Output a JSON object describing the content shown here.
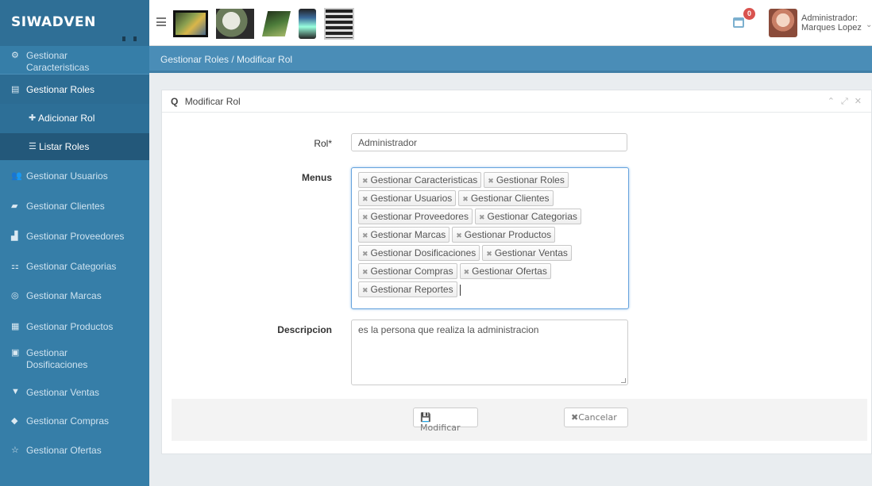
{
  "brand": {
    "name": "SIWADVEN"
  },
  "header": {
    "notification_count": "0",
    "user": {
      "role": "Administrador:",
      "name": "Marques Lopez"
    }
  },
  "sidebar": {
    "items": [
      {
        "label": "Gestionar Caracteristicas",
        "icon": "gears-icon"
      },
      {
        "label": "Gestionar Roles",
        "icon": "table-icon"
      },
      {
        "label": "Adicionar Rol",
        "icon": "plus-icon"
      },
      {
        "label": "Listar Roles",
        "icon": "list-icon"
      },
      {
        "label": "Gestionar Usuarios",
        "icon": "users-icon"
      },
      {
        "label": "Gestionar Clientes",
        "icon": "briefcase-icon"
      },
      {
        "label": "Gestionar Proveedores",
        "icon": "truck-icon"
      },
      {
        "label": "Gestionar Categorias",
        "icon": "sitemap-icon"
      },
      {
        "label": "Gestionar Marcas",
        "icon": "tag-icon"
      },
      {
        "label": "Gestionar Productos",
        "icon": "product-icon"
      },
      {
        "label": "Gestionar Dosificaciones",
        "icon": "calculator-icon"
      },
      {
        "label": "Gestionar Ventas",
        "icon": "cart-icon"
      },
      {
        "label": "Gestionar Compras",
        "icon": "purchase-icon"
      },
      {
        "label": "Gestionar Ofertas",
        "icon": "star-icon"
      }
    ]
  },
  "breadcrumb": {
    "text": "Gestionar Roles / Modificar Rol"
  },
  "panel": {
    "title": "Modificar Rol"
  },
  "form": {
    "rol_label": "Rol*",
    "rol_value": "Administrador",
    "menus_label": "Menus",
    "menus": [
      [
        "Gestionar Caracteristicas",
        "Gestionar Roles"
      ],
      [
        "Gestionar Usuarios",
        "Gestionar Clientes"
      ],
      [
        "Gestionar Proveedores",
        "Gestionar Categorias"
      ],
      [
        "Gestionar Marcas",
        "Gestionar Productos"
      ],
      [
        "Gestionar Dosificaciones",
        "Gestionar Ventas"
      ],
      [
        "Gestionar Compras",
        "Gestionar Ofertas"
      ],
      [
        "Gestionar Reportes"
      ]
    ],
    "descripcion_label": "Descripcion",
    "descripcion_value": "es la persona que realiza la administracion"
  },
  "buttons": {
    "modificar": "Modificar",
    "cancelar": "Cancelar"
  }
}
